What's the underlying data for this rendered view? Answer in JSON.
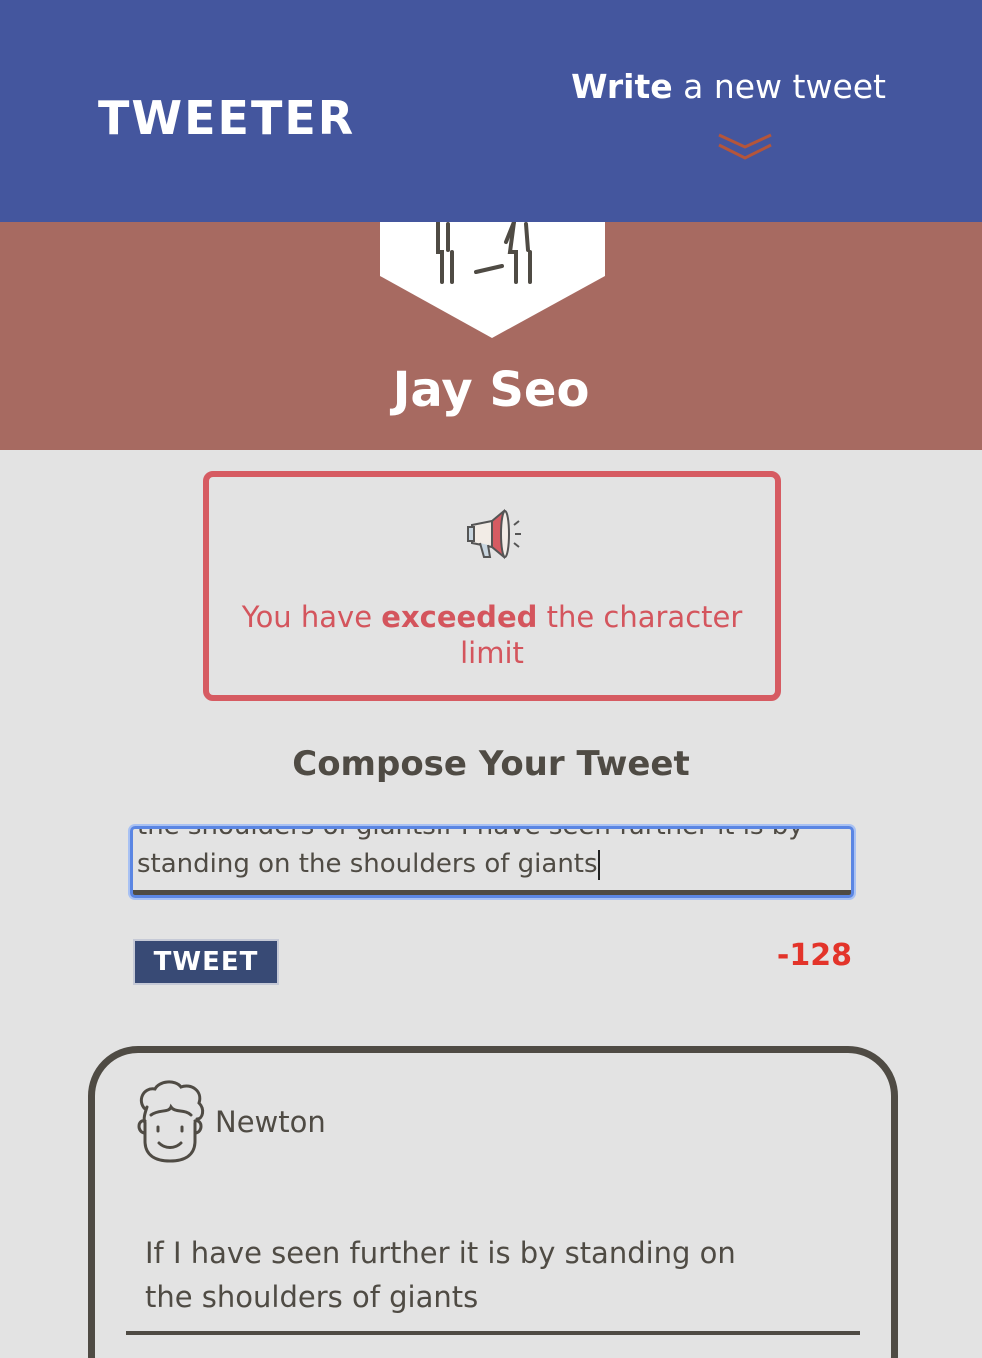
{
  "header": {
    "brand": "TWEETER",
    "write_bold": "Write",
    "write_rest": " a new tweet",
    "chevron_icon": "double-chevron-down-icon",
    "background": "#44569e"
  },
  "profile": {
    "name": "Jay Seo",
    "avatar_icon": "person-avatar-icon",
    "background": "#a76a61"
  },
  "error": {
    "icon": "megaphone-icon",
    "text_before": "You have ",
    "text_bold": "exceeded",
    "text_after": " the character limit",
    "color": "#d65b62"
  },
  "compose": {
    "title": "Compose Your Tweet",
    "input_value": "the shoulders of giantsIf I have seen further it is by standing on the shoulders of giants",
    "button_label": "TWEET",
    "counter": "-128",
    "counter_color": "#e3342a"
  },
  "tweets": [
    {
      "author": "Newton",
      "avatar_icon": "curly-hair-face-icon",
      "content": "If I have seen further it is by standing on the shoulders of giants"
    }
  ]
}
